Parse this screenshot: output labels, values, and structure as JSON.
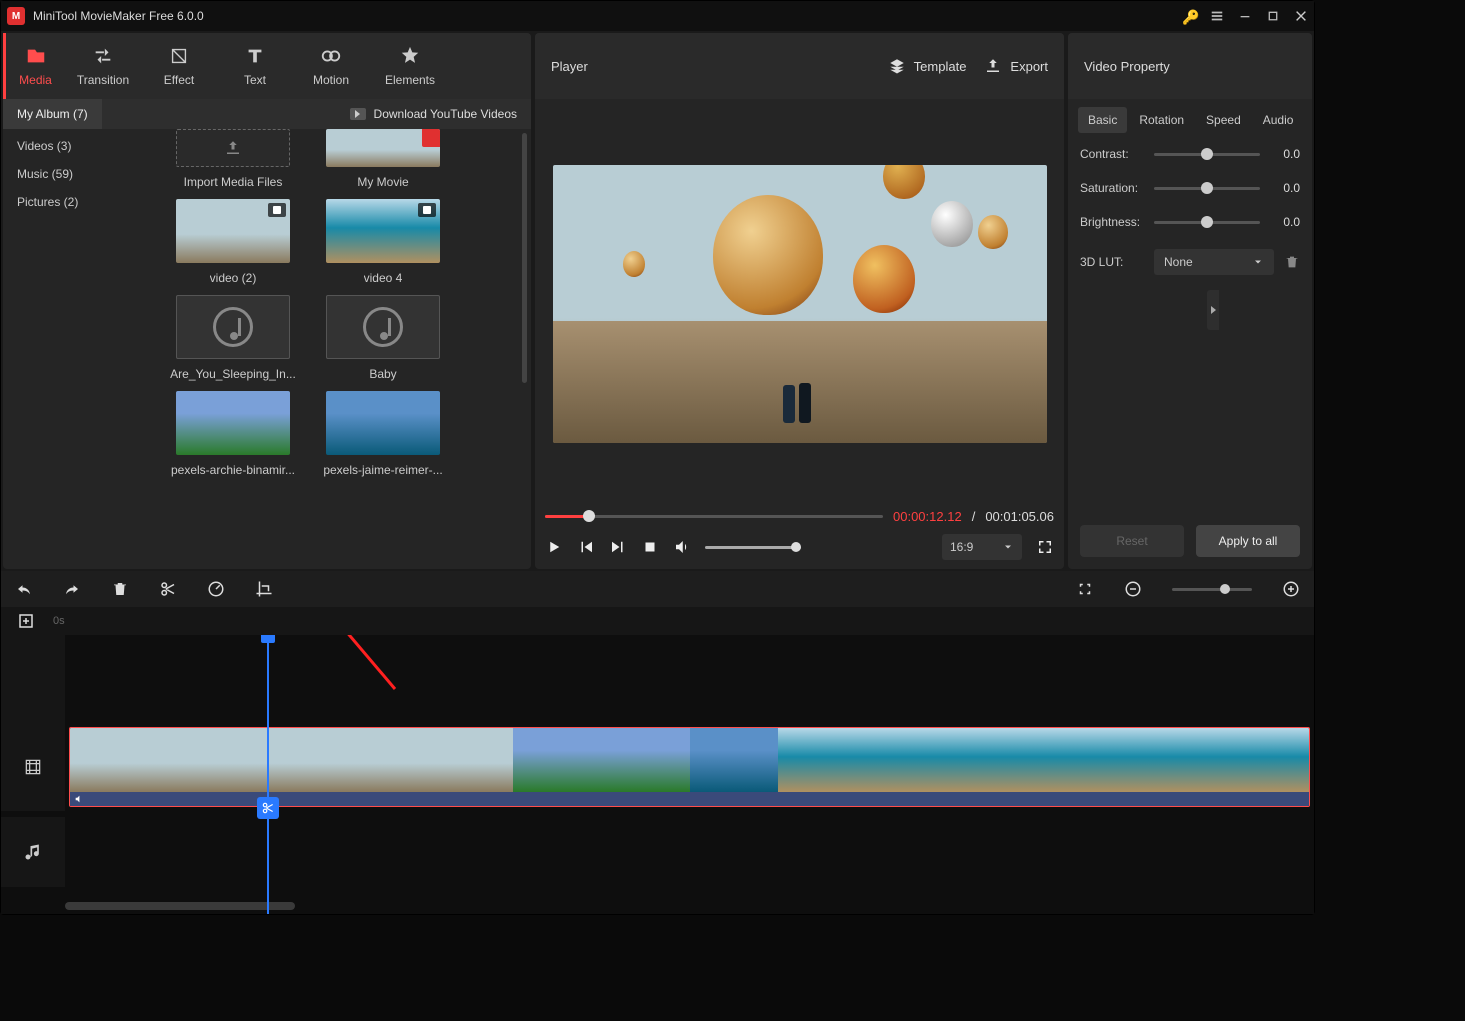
{
  "app": {
    "title": "MiniTool MovieMaker Free 6.0.0"
  },
  "topTabs": {
    "media": "Media",
    "transition": "Transition",
    "effect": "Effect",
    "text": "Text",
    "motion": "Motion",
    "elements": "Elements"
  },
  "mediaHeader": {
    "album": "My Album (7)",
    "youtube": "Download YouTube Videos"
  },
  "mediaCats": {
    "videos": "Videos (3)",
    "music": "Music (59)",
    "pictures": "Pictures (2)"
  },
  "mediaItems": {
    "import": "Import Media Files",
    "mymovie": "My Movie",
    "v2": "video (2)",
    "v4": "video 4",
    "a1": "Are_You_Sleeping_In...",
    "a2": "Baby",
    "p1": "pexels-archie-binamir...",
    "p2": "pexels-jaime-reimer-..."
  },
  "player": {
    "title": "Player",
    "template": "Template",
    "export": "Export",
    "timeCurrent": "00:00:12.12",
    "timeTotal": "00:01:05.06",
    "ratio": "16:9",
    "sep": "/"
  },
  "property": {
    "title": "Video Property",
    "tabs": {
      "basic": "Basic",
      "rotation": "Rotation",
      "speed": "Speed",
      "audio": "Audio"
    },
    "labels": {
      "contrast": "Contrast:",
      "saturation": "Saturation:",
      "brightness": "Brightness:",
      "lut": "3D LUT:"
    },
    "values": {
      "contrast": "0.0",
      "saturation": "0.0",
      "brightness": "0.0"
    },
    "lutValue": "None",
    "reset": "Reset",
    "apply": "Apply to all"
  },
  "timeline": {
    "zero": "0s"
  }
}
